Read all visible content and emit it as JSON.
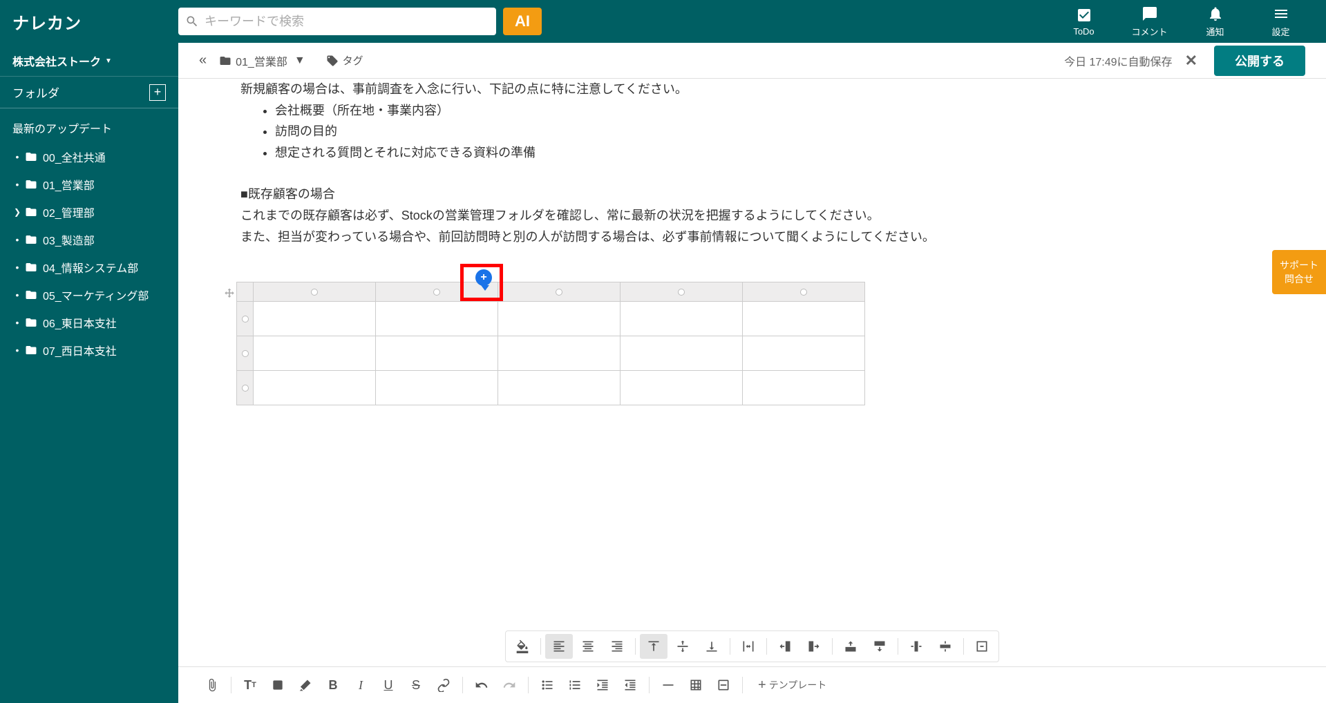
{
  "header": {
    "logo": "ナレカン",
    "search_placeholder": "キーワードで検索",
    "ai_label": "AI",
    "nav": [
      {
        "icon": "todo",
        "label": "ToDo"
      },
      {
        "icon": "comment",
        "label": "コメント"
      },
      {
        "icon": "bell",
        "label": "通知"
      },
      {
        "icon": "menu",
        "label": "設定"
      }
    ]
  },
  "sidebar": {
    "company": "株式会社ストーク",
    "folder_label": "フォルダ",
    "updates_label": "最新のアップデート",
    "folders": [
      {
        "label": "00_全社共通",
        "expandable": false
      },
      {
        "label": "01_営業部",
        "expandable": false
      },
      {
        "label": "02_管理部",
        "expandable": true
      },
      {
        "label": "03_製造部",
        "expandable": false
      },
      {
        "label": "04_情報システム部",
        "expandable": false
      },
      {
        "label": "05_マーケティング部",
        "expandable": false
      },
      {
        "label": "06_東日本支社",
        "expandable": false
      },
      {
        "label": "07_西日本支社",
        "expandable": false
      }
    ]
  },
  "doc_header": {
    "breadcrumb_folder": "01_営業部",
    "tag_label": "タグ",
    "save_status": "今日 17:49に自動保存",
    "publish_label": "公開する"
  },
  "document": {
    "partial_line": "新規顧客の場合は、事前調査を入念に行い、下記の点に特に注意してください。",
    "bullets": [
      "会社概要（所在地・事業内容）",
      "訪問の目的",
      "想定される質問とそれに対応できる資料の準備"
    ],
    "section2_head": "■既存顧客の場合",
    "section2_p1": "これまでの既存顧客は必ず、Stockの営業管理フォルダを確認し、常に最新の状況を把握するようにしてください。",
    "section2_p2": "また、担当が変わっている場合や、前回訪問時と別の人が訪問する場合は、必ず事前情報について聞くようにしてください。"
  },
  "table": {
    "columns": 5,
    "rows": 3
  },
  "support": {
    "line1": "サポート",
    "line2": "問合せ"
  },
  "format_toolbar": {
    "template_label": "テンプレート"
  }
}
